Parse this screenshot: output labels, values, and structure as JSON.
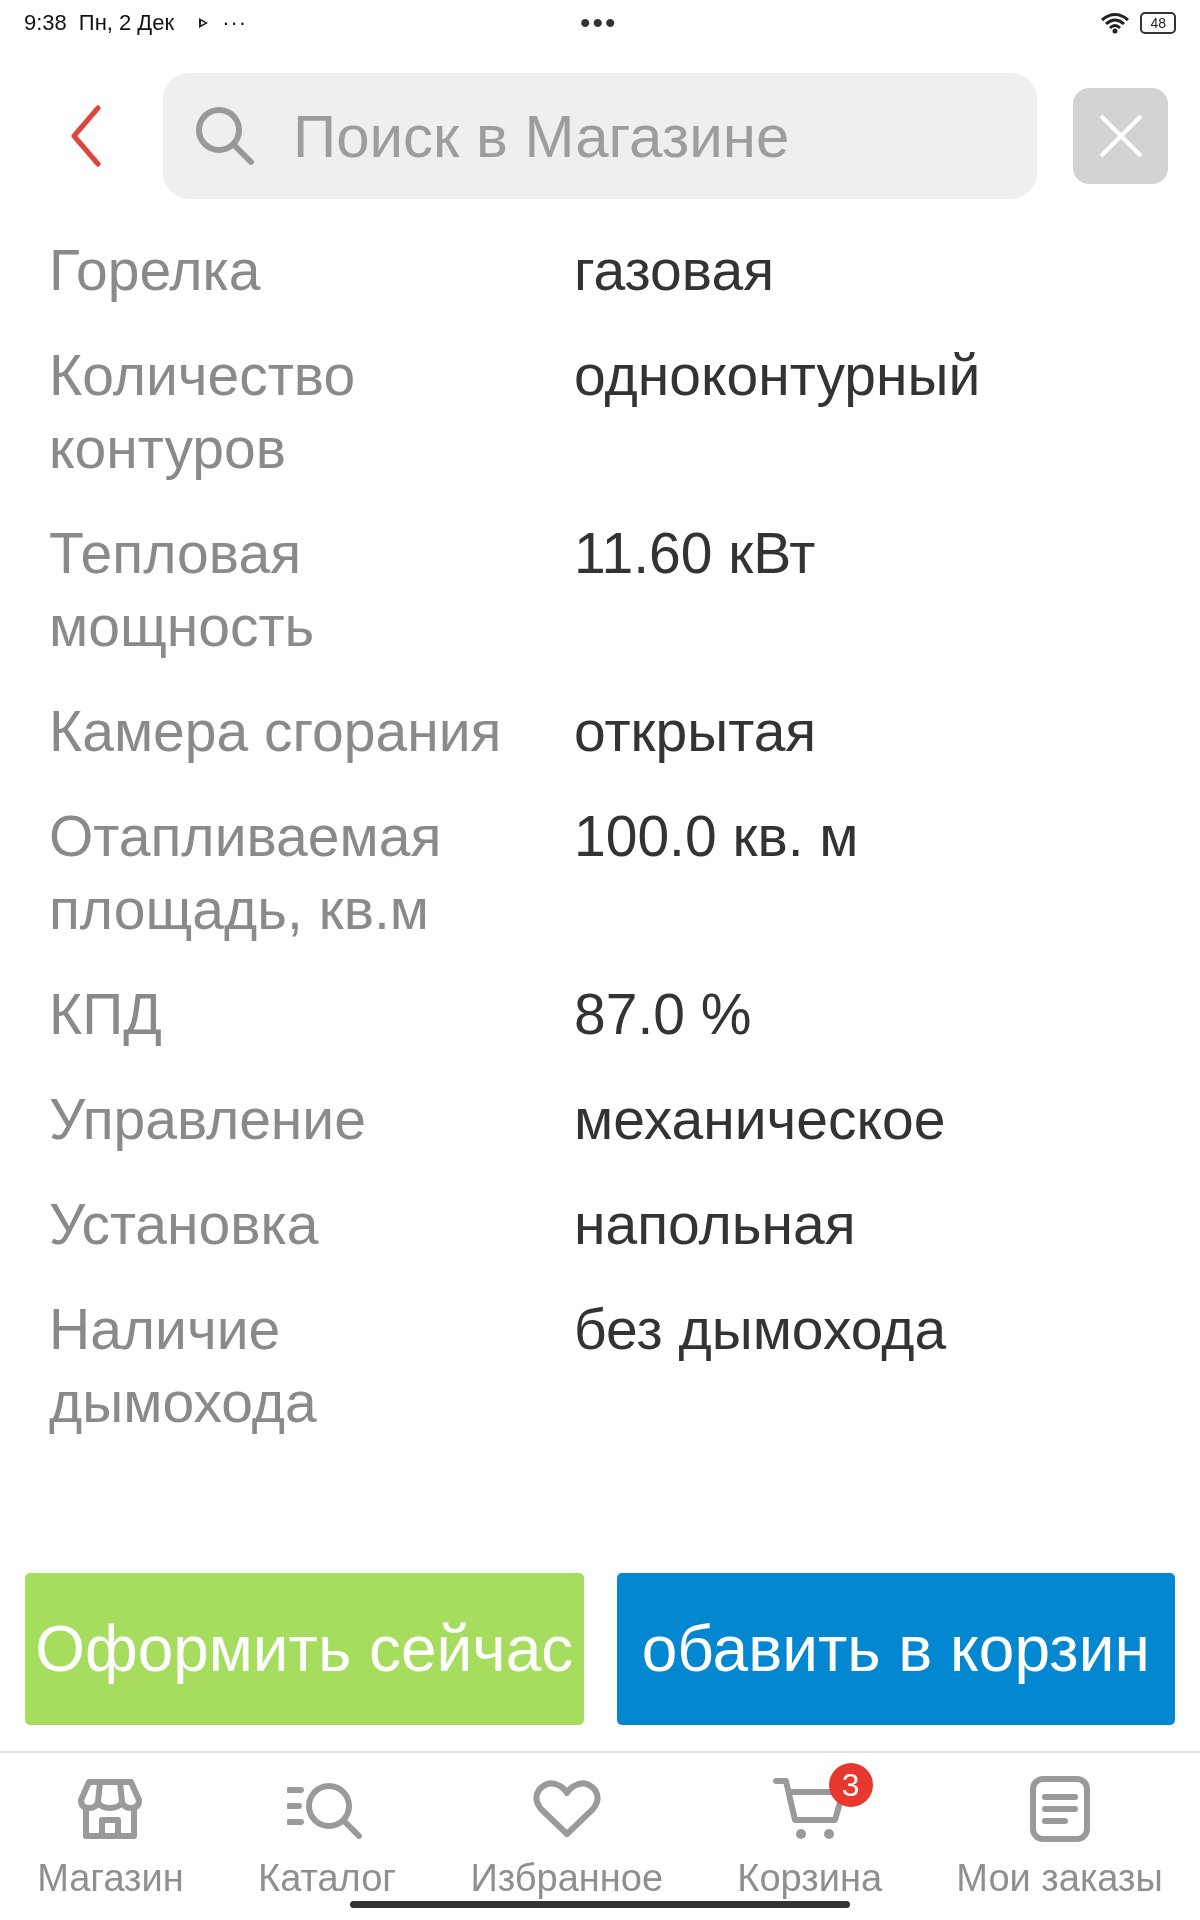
{
  "status_bar": {
    "time": "9:38",
    "date": "Пн, 2 Дек",
    "more": "···",
    "center": "•••",
    "battery": "48"
  },
  "header": {
    "search": {
      "placeholder": "Поиск в Магазине"
    }
  },
  "specs": [
    {
      "label": "Горелка",
      "value": "газовая"
    },
    {
      "label": "Количество контуров",
      "value": "одноконтурный"
    },
    {
      "label": "Тепловая мощность",
      "value": "11.60 кВт"
    },
    {
      "label": "Камера сгорания",
      "value": "открытая"
    },
    {
      "label": "Отапливаемая площадь, кв.м",
      "value": "100.0 кв. м"
    },
    {
      "label": "КПД",
      "value": "87.0 %"
    },
    {
      "label": "Управление",
      "value": "механическое"
    },
    {
      "label": "Установка",
      "value": "напольная"
    },
    {
      "label": "Наличие дымохода",
      "value": "без дымохода"
    }
  ],
  "actions": [
    {
      "label": "Оформить сейчас",
      "kind": "buy"
    },
    {
      "label": "обавить в корзин",
      "kind": "cart"
    }
  ],
  "bottom_nav": [
    {
      "label": "Магазин",
      "kind": "store"
    },
    {
      "label": "Каталог",
      "kind": "catalog"
    },
    {
      "label": "Избранное",
      "kind": "heart"
    },
    {
      "label": "Корзина",
      "kind": "cart",
      "badge": "3"
    },
    {
      "label": "Мои заказы",
      "kind": "orders"
    }
  ]
}
